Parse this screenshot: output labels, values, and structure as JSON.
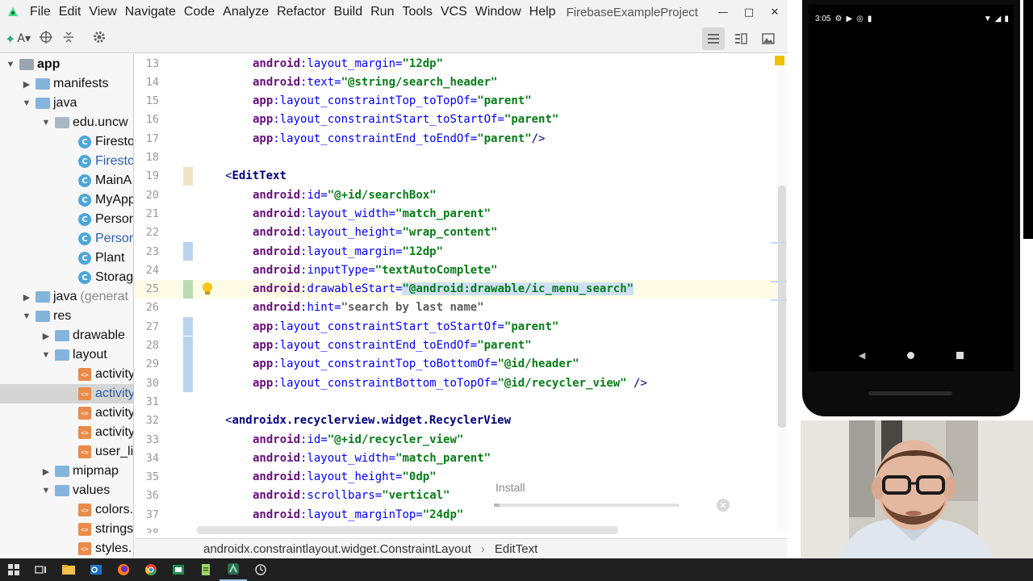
{
  "menu": {
    "items": [
      "File",
      "Edit",
      "View",
      "Navigate",
      "Code",
      "Analyze",
      "Refactor",
      "Build",
      "Run",
      "Tools",
      "VCS",
      "Window",
      "Help"
    ],
    "project_title": "FirebaseExampleProject"
  },
  "toolbar": {
    "view_label": "A▾"
  },
  "tree": {
    "rows": [
      {
        "label": "app",
        "arrow": "▼",
        "icon": "module-icon"
      },
      {
        "label": "manifests",
        "arrow": "▶",
        "icon": "folder-icon"
      },
      {
        "label": "java",
        "arrow": "▼",
        "icon": "folder-icon"
      },
      {
        "label": "edu.uncw",
        "arrow": "▼",
        "icon": "package-icon"
      },
      {
        "label": "Firesto",
        "icon": "class-icon"
      },
      {
        "label": "Firesto",
        "icon": "class-icon"
      },
      {
        "label": "MainA",
        "icon": "class-icon"
      },
      {
        "label": "MyApp",
        "icon": "class-icon"
      },
      {
        "label": "Person",
        "icon": "class-icon"
      },
      {
        "label": "Person",
        "icon": "class-icon"
      },
      {
        "label": "Plant",
        "icon": "class-icon"
      },
      {
        "label": "Storag",
        "icon": "class-icon"
      },
      {
        "label": "java",
        "label_suffix": "(generat",
        "arrow": "▶",
        "icon": "folder-icon"
      },
      {
        "label": "res",
        "arrow": "▼",
        "icon": "folder-icon"
      },
      {
        "label": "drawable",
        "arrow": "▶",
        "icon": "folder-icon"
      },
      {
        "label": "layout",
        "arrow": "▼",
        "icon": "folder-icon"
      },
      {
        "label": "activity",
        "icon": "xml-file-icon"
      },
      {
        "label": "activity",
        "icon": "xml-file-icon"
      },
      {
        "label": "activity",
        "icon": "xml-file-icon"
      },
      {
        "label": "activity",
        "icon": "xml-file-icon"
      },
      {
        "label": "user_li",
        "icon": "xml-file-icon"
      },
      {
        "label": "mipmap",
        "arrow": "▶",
        "icon": "folder-icon"
      },
      {
        "label": "values",
        "arrow": "▼",
        "icon": "folder-icon"
      },
      {
        "label": "colors.",
        "icon": "xml-file-icon"
      },
      {
        "label": "strings",
        "icon": "xml-file-icon"
      },
      {
        "label": "styles.",
        "icon": "xml-file-icon"
      }
    ]
  },
  "code": {
    "lines": [
      {
        "n": "13",
        "ns": "android",
        "attr": "layout_margin",
        "val": "\"12dp\""
      },
      {
        "n": "14",
        "ns": "android",
        "attr": "text",
        "val": "\"@string/search_header\""
      },
      {
        "n": "15",
        "ns": "app",
        "attr": "layout_constraintTop_toTopOf",
        "val": "\"parent\""
      },
      {
        "n": "16",
        "ns": "app",
        "attr": "layout_constraintStart_toStartOf",
        "val": "\"parent\""
      },
      {
        "n": "17",
        "ns": "app",
        "attr": "layout_constraintEnd_toEndOf",
        "val": "\"parent\"",
        "tail": "/>"
      },
      {
        "n": "18"
      },
      {
        "n": "19",
        "tag_open": "<",
        "tag": "EditText"
      },
      {
        "n": "20",
        "ns": "android",
        "attr": "id",
        "val": "\"@+id/searchBox\""
      },
      {
        "n": "21",
        "ns": "android",
        "attr": "layout_width",
        "val": "\"match_parent\""
      },
      {
        "n": "22",
        "ns": "android",
        "attr": "layout_height",
        "val": "\"wrap_content\""
      },
      {
        "n": "23",
        "ns": "android",
        "attr": "layout_margin",
        "val": "\"12dp\""
      },
      {
        "n": "24",
        "ns": "android",
        "attr": "inputType",
        "val": "\"textAutoComplete\""
      },
      {
        "n": "25",
        "ns": "android",
        "attr": "drawableStart",
        "val": "\"@android:drawable/ic_menu_search\""
      },
      {
        "n": "26",
        "ns": "android",
        "attr": "hint",
        "val": "\"search by last name\""
      },
      {
        "n": "27",
        "ns": "app",
        "attr": "layout_constraintStart_toStartOf",
        "val": "\"parent\""
      },
      {
        "n": "28",
        "ns": "app",
        "attr": "layout_constraintEnd_toEndOf",
        "val": "\"parent\""
      },
      {
        "n": "29",
        "ns": "app",
        "attr": "layout_constraintTop_toBottomOf",
        "val": "\"@id/header\""
      },
      {
        "n": "30",
        "ns": "app",
        "attr": "layout_constraintBottom_toTopOf",
        "val": "\"@id/recycler_view\"",
        "tail": " />"
      },
      {
        "n": "31"
      },
      {
        "n": "32",
        "tag_open": "<",
        "tag": "androidx.recyclerview.widget.RecyclerView"
      },
      {
        "n": "33",
        "ns": "android",
        "attr": "id",
        "val": "\"@+id/recycler_view\""
      },
      {
        "n": "34",
        "ns": "android",
        "attr": "layout_width",
        "val": "\"match_parent\""
      },
      {
        "n": "35",
        "ns": "android",
        "attr": "layout_height",
        "val": "\"0dp\""
      },
      {
        "n": "36",
        "ns": "android",
        "attr": "scrollbars",
        "val": "\"vertical\""
      },
      {
        "n": "37",
        "ns": "android",
        "attr": "layout_marginTop",
        "val": "\"24dp\""
      },
      {
        "n": "38",
        "ns": "app",
        "attr": "layout_constraintTop_toBottomOf",
        "val": "\"@id/searchBox\""
      }
    ]
  },
  "install": {
    "label": "Install",
    "progress": 0.03
  },
  "breadcrumb": {
    "items": [
      "androidx.constraintlayout.widget.ConstraintLayout",
      "EditText"
    ]
  },
  "emulator": {
    "time": "3:05"
  },
  "colors": {
    "accent": "#3d7ac6",
    "tag": "#000080",
    "attribute": "#0000ff",
    "namespace": "#660e7a",
    "value": "#067d17"
  }
}
